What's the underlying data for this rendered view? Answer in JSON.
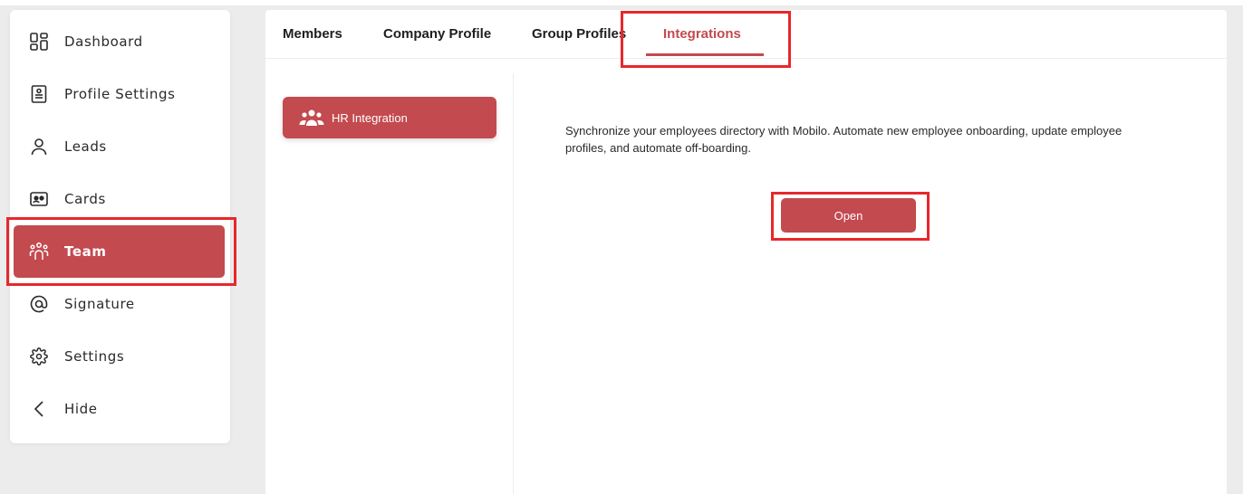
{
  "sidebar": {
    "items": [
      {
        "label": "Dashboard",
        "icon": "dashboard-icon"
      },
      {
        "label": "Profile Settings",
        "icon": "profile-card-icon"
      },
      {
        "label": "Leads",
        "icon": "user-icon"
      },
      {
        "label": "Cards",
        "icon": "id-card-icon"
      },
      {
        "label": "Team",
        "icon": "team-icon",
        "active": true
      },
      {
        "label": "Signature",
        "icon": "at-sign-icon"
      },
      {
        "label": "Settings",
        "icon": "gear-icon"
      },
      {
        "label": "Hide",
        "icon": "chevron-left-icon"
      }
    ]
  },
  "tabs": [
    {
      "label": "Members"
    },
    {
      "label": "Company Profile"
    },
    {
      "label": "Group Profiles"
    },
    {
      "label": "Integrations",
      "active": true
    }
  ],
  "integrations": {
    "hr_button_label": "HR Integration",
    "description": "Synchronize your employees directory with Mobilo. Automate new employee onboarding, update employee profiles, and automate off-boarding.",
    "open_button_label": "Open"
  },
  "colors": {
    "accent": "#c34a4f",
    "highlight": "#e8282b",
    "background": "#ececec"
  }
}
